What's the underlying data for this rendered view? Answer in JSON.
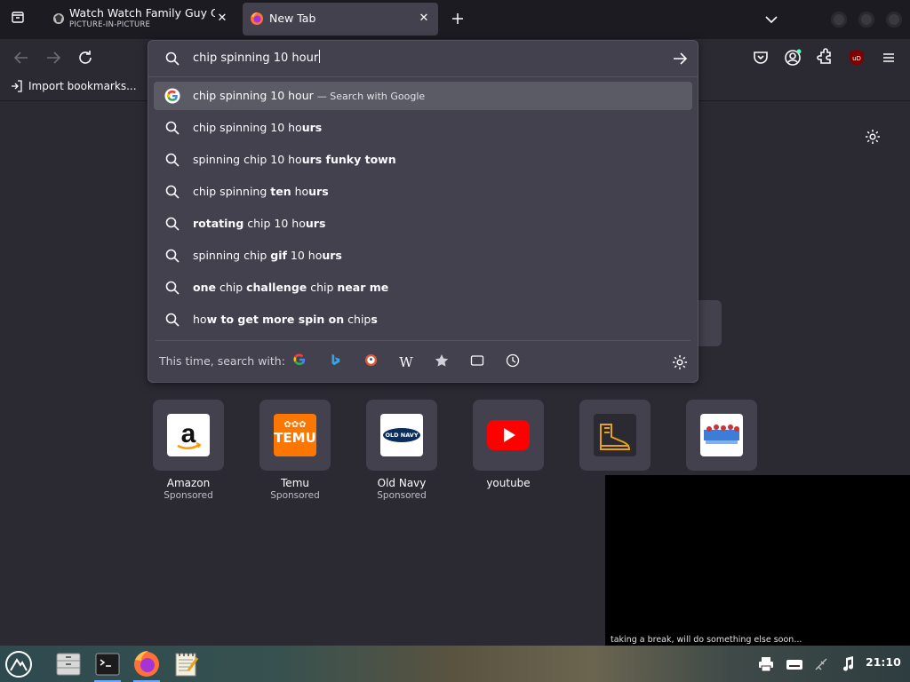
{
  "tabs": [
    {
      "title": "Watch Watch Family Guy Onlin",
      "subtitle": "PICTURE-IN-PICTURE"
    },
    {
      "title": "New Tab"
    }
  ],
  "bookmarks": {
    "import_label": "Import bookmarks..."
  },
  "urlbar": {
    "value": "chip spinning 10 hour",
    "suggestions": [
      {
        "plain": "chip spinning 10 hour",
        "hint": "— Search with Google",
        "type": "google"
      },
      {
        "parts": [
          [
            "chip spinning 10 ho",
            false
          ],
          [
            "urs",
            true
          ]
        ]
      },
      {
        "parts": [
          [
            "spinning chip 10 ho",
            false
          ],
          [
            "urs funky town",
            true
          ]
        ]
      },
      {
        "parts": [
          [
            "chip spinning ",
            false
          ],
          [
            "ten",
            true
          ],
          [
            " ho",
            false
          ],
          [
            "urs",
            true
          ]
        ]
      },
      {
        "parts": [
          [
            "rotating",
            true
          ],
          [
            " chip 10 ho",
            false
          ],
          [
            "urs",
            true
          ]
        ]
      },
      {
        "parts": [
          [
            "spinning chip ",
            false
          ],
          [
            "gif",
            true
          ],
          [
            " 10 ho",
            false
          ],
          [
            "urs",
            true
          ]
        ]
      },
      {
        "parts": [
          [
            "one",
            true
          ],
          [
            " chip ",
            false
          ],
          [
            "challenge",
            true
          ],
          [
            " chip ",
            false
          ],
          [
            "near me",
            true
          ]
        ]
      },
      {
        "parts": [
          [
            "ho",
            false
          ],
          [
            "w to get more spin on",
            true
          ],
          [
            " chip",
            false
          ],
          [
            "s",
            true
          ]
        ]
      }
    ],
    "oneoff_label": "This time, search with:",
    "engines": [
      "google",
      "bing",
      "duckduckgo",
      "wikipedia",
      "bookmarks",
      "tabs",
      "history"
    ]
  },
  "top_sites": [
    {
      "name": "Amazon",
      "sponsored": "Sponsored"
    },
    {
      "name": "Temu",
      "sponsored": "Sponsored"
    },
    {
      "name": "Old Navy",
      "sponsored": "Sponsored"
    },
    {
      "name": "youtube",
      "sponsored": ""
    },
    {
      "name": "",
      "sponsored": ""
    },
    {
      "name": "",
      "sponsored": ""
    }
  ],
  "tile_logos": {
    "temu": "TEMU",
    "temu_top": "✿✿✿",
    "oldnavy": "OLD NAVY"
  },
  "pip": {
    "caption": "taking a break, will do something else soon..."
  },
  "taskbar": {
    "clock": "21:10"
  },
  "colors": {
    "accent": "#6aa9ff",
    "toolbar": "#2b2a33",
    "panel": "#42414d",
    "selected_row": "#5b5b66"
  }
}
